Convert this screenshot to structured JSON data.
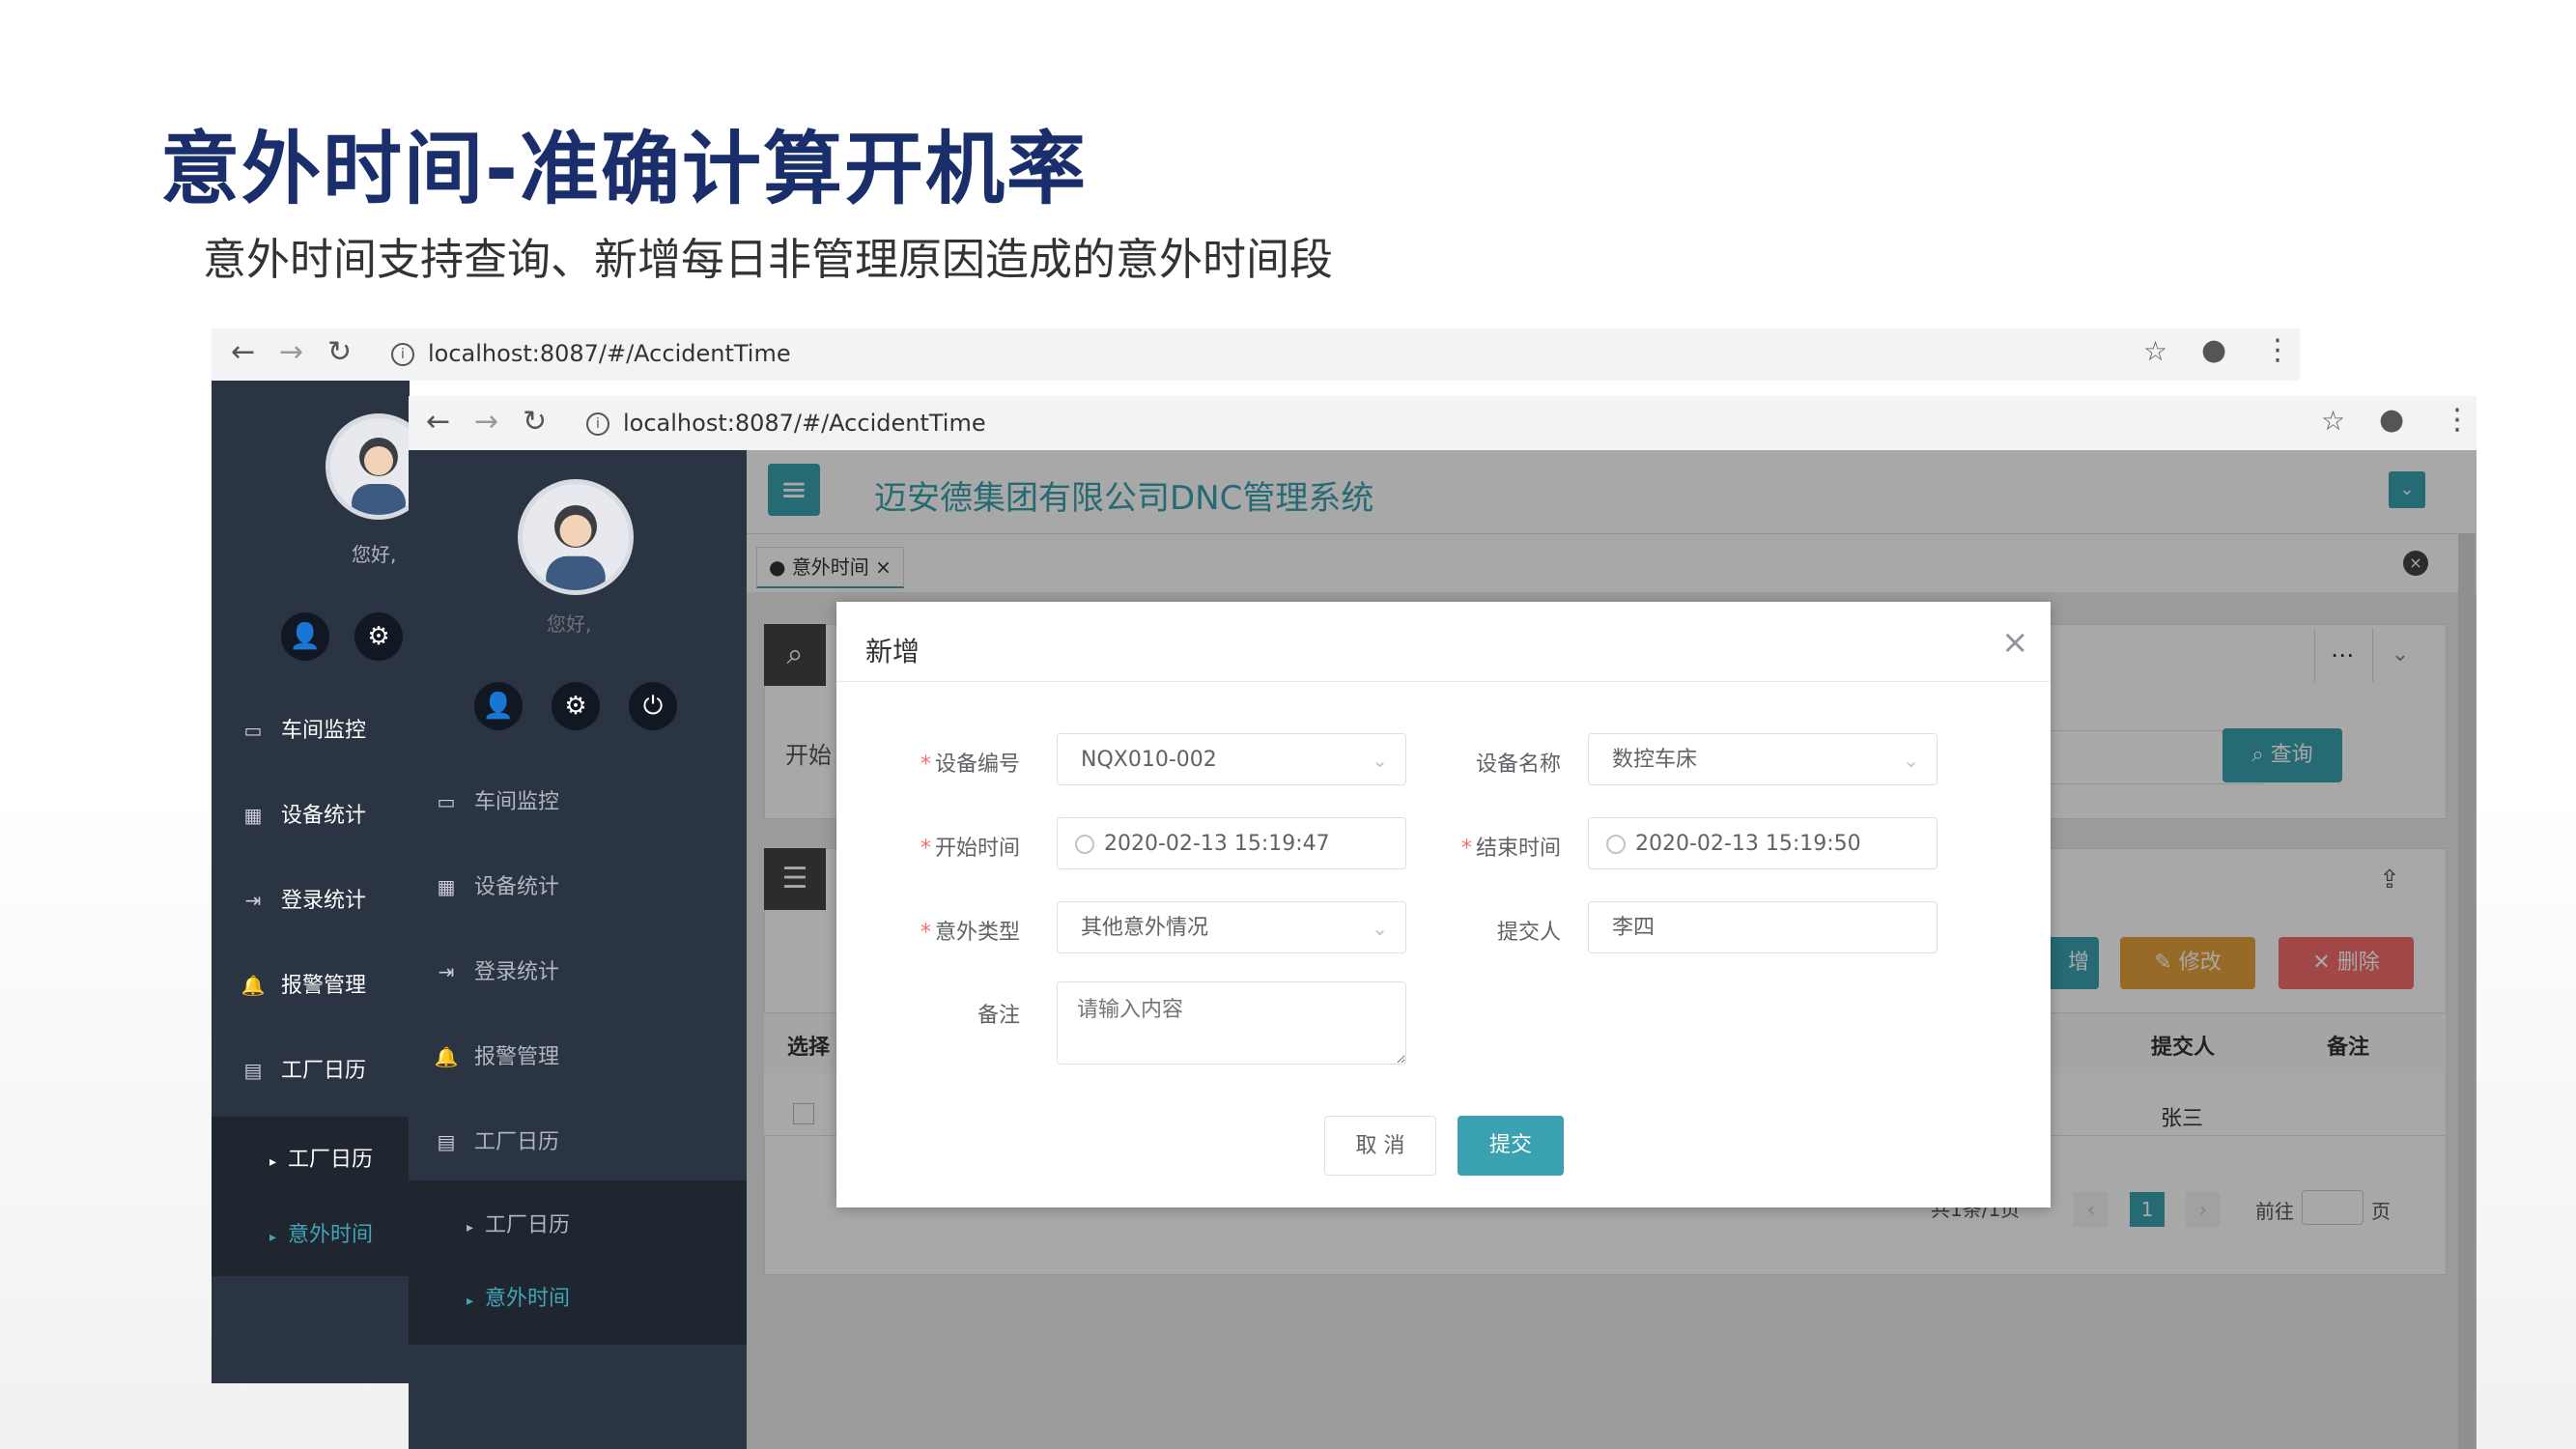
{
  "slide": {
    "title": "意外时间-准确计算开机率",
    "subtitle": "意外时间支持查询、新增每日非管理原因造成的意外时间段"
  },
  "browser": {
    "url": "localhost:8087/#/AccidentTime"
  },
  "sidebar": {
    "greeting": "您好,",
    "items": [
      {
        "label": "车间监控",
        "icon": "monitor-icon"
      },
      {
        "label": "设备统计",
        "icon": "table-icon"
      },
      {
        "label": "登录统计",
        "icon": "login-icon"
      },
      {
        "label": "报警管理",
        "icon": "bell-icon"
      },
      {
        "label": "工厂日历",
        "icon": "calendar-icon"
      }
    ],
    "subitems": [
      {
        "label": "工厂日历"
      },
      {
        "label": "意外时间"
      }
    ]
  },
  "app": {
    "system_title": "迈安德集团有限公司DNC管理系统",
    "tab_label": "意外时间",
    "search_button": "查询",
    "start_label_partial": "开始",
    "edit_button": "修改",
    "delete_button": "删除",
    "add_button_partial": "增",
    "table_headers": {
      "select": "选择",
      "submitter": "提交人",
      "remark": "备注"
    },
    "table_row": {
      "submitter": "张三"
    },
    "pagination": {
      "summary": "共1条/1页",
      "current_page": "1",
      "goto_label": "前往",
      "page_unit": "页"
    }
  },
  "modal": {
    "title": "新增",
    "fields": {
      "device_code": {
        "label": "设备编号",
        "value": "NQX010-002",
        "required": true
      },
      "device_name": {
        "label": "设备名称",
        "value": "数控车床",
        "required": false
      },
      "start_time": {
        "label": "开始时间",
        "value": "2020-02-13 15:19:47",
        "required": true
      },
      "end_time": {
        "label": "结束时间",
        "value": "2020-02-13 15:19:50",
        "required": true
      },
      "accident_type": {
        "label": "意外类型",
        "value": "其他意外情况",
        "required": true
      },
      "submitter": {
        "label": "提交人",
        "value": "李四",
        "required": false
      },
      "remark": {
        "label": "备注",
        "placeholder": "请输入内容"
      }
    },
    "cancel_button": "取 消",
    "submit_button": "提交"
  },
  "colors": {
    "accent": "#3aa1b0",
    "title_navy": "#1a2e6b",
    "sidebar": "#2b3442",
    "required": "#f56c6c"
  }
}
